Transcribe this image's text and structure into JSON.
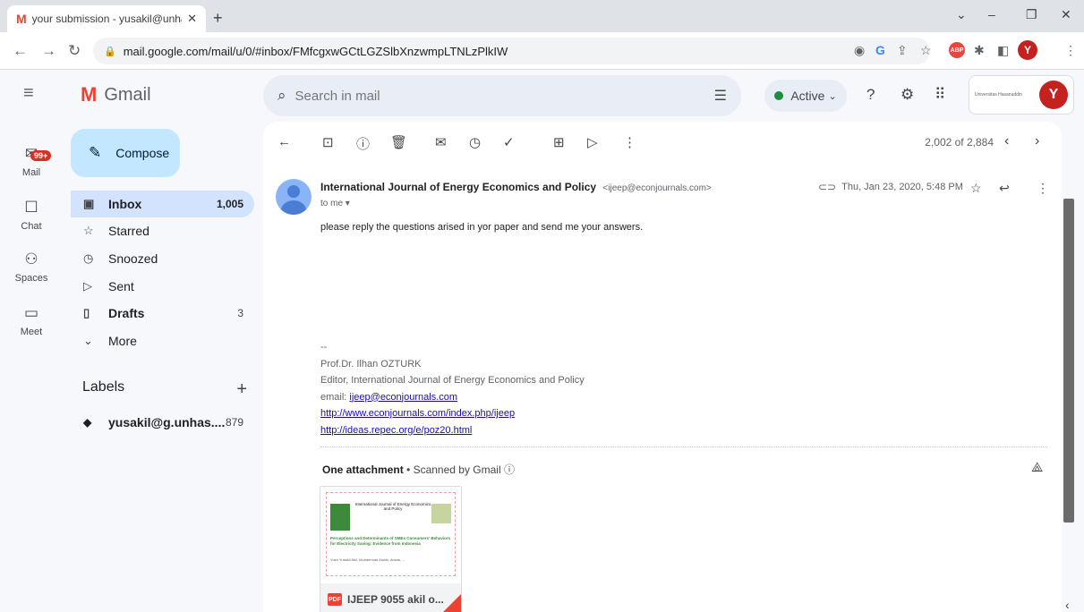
{
  "browser": {
    "tab_title": "your submission - yusakil@unha:",
    "tab_favicon": "M",
    "tab_close": "✕",
    "new_tab": "+",
    "url": "mail.google.com/mail/u/0/#inbox/FMfcgxwGCtLGZSlbXnzwmpLTNLzPlkIW",
    "profile_initial": "Y",
    "abp": "ABP"
  },
  "header": {
    "app_name": "Gmail",
    "search_placeholder": "Search in mail",
    "status": "Active",
    "account_initial": "Y",
    "org_text": "Universitas Hasanuddin"
  },
  "rail": {
    "mail_badge": "99+",
    "items": [
      {
        "label": "Mail",
        "icon": "mail-icon"
      },
      {
        "label": "Chat",
        "icon": "chat-icon"
      },
      {
        "label": "Spaces",
        "icon": "spaces-icon"
      },
      {
        "label": "Meet",
        "icon": "meet-icon"
      }
    ]
  },
  "nav": {
    "compose": "Compose",
    "items": [
      {
        "label": "Inbox",
        "count": "1,005",
        "icon": "inbox-icon"
      },
      {
        "label": "Starred",
        "count": "",
        "icon": "star-icon"
      },
      {
        "label": "Snoozed",
        "count": "",
        "icon": "clock-icon"
      },
      {
        "label": "Sent",
        "count": "",
        "icon": "send-icon"
      },
      {
        "label": "Drafts",
        "count": "3",
        "icon": "draft-icon"
      },
      {
        "label": "More",
        "count": "",
        "icon": "chevron-down-icon"
      }
    ],
    "labels_title": "Labels",
    "labels": [
      {
        "name": "yusakil@g.unhas....",
        "count": "879"
      }
    ]
  },
  "toolbar": {
    "pager": "2,002 of 2,884"
  },
  "email": {
    "sender_name": "International Journal of Energy Economics and Policy",
    "sender_email": "<ijeep@econjournals.com>",
    "to": "to me",
    "date": "Thu, Jan 23, 2020, 5:48 PM",
    "body": "please reply the questions arised in yor paper and send me your answers.",
    "sig_dash": "--",
    "sig_name": "Prof.Dr. Ilhan OZTURK",
    "sig_title": "Editor, International Journal of Energy Economics and Policy",
    "sig_email_label": "email:",
    "sig_email": "ijeep@econjournals.com",
    "sig_link1": "http://www.econjournals.com/index.php/ijeep",
    "sig_link2": "http://ideas.repec.org/e/poz20.html"
  },
  "attachment": {
    "header_bold": "One attachment",
    "header_rest": "Scanned by Gmail",
    "file_type": "PDF",
    "file_name": "IJEEP 9055 akil o...",
    "thumb_title": "International Journal of Energy Economics and Policy",
    "thumb_heading": "Perceptions and Determinants of SMEs Consumers' Behaviors for Electricity Saving: Evidence from Indonesia",
    "thumb_authors": "Yusri Yusakil Akil, Muhammad Aswin, Anwar, ..."
  }
}
